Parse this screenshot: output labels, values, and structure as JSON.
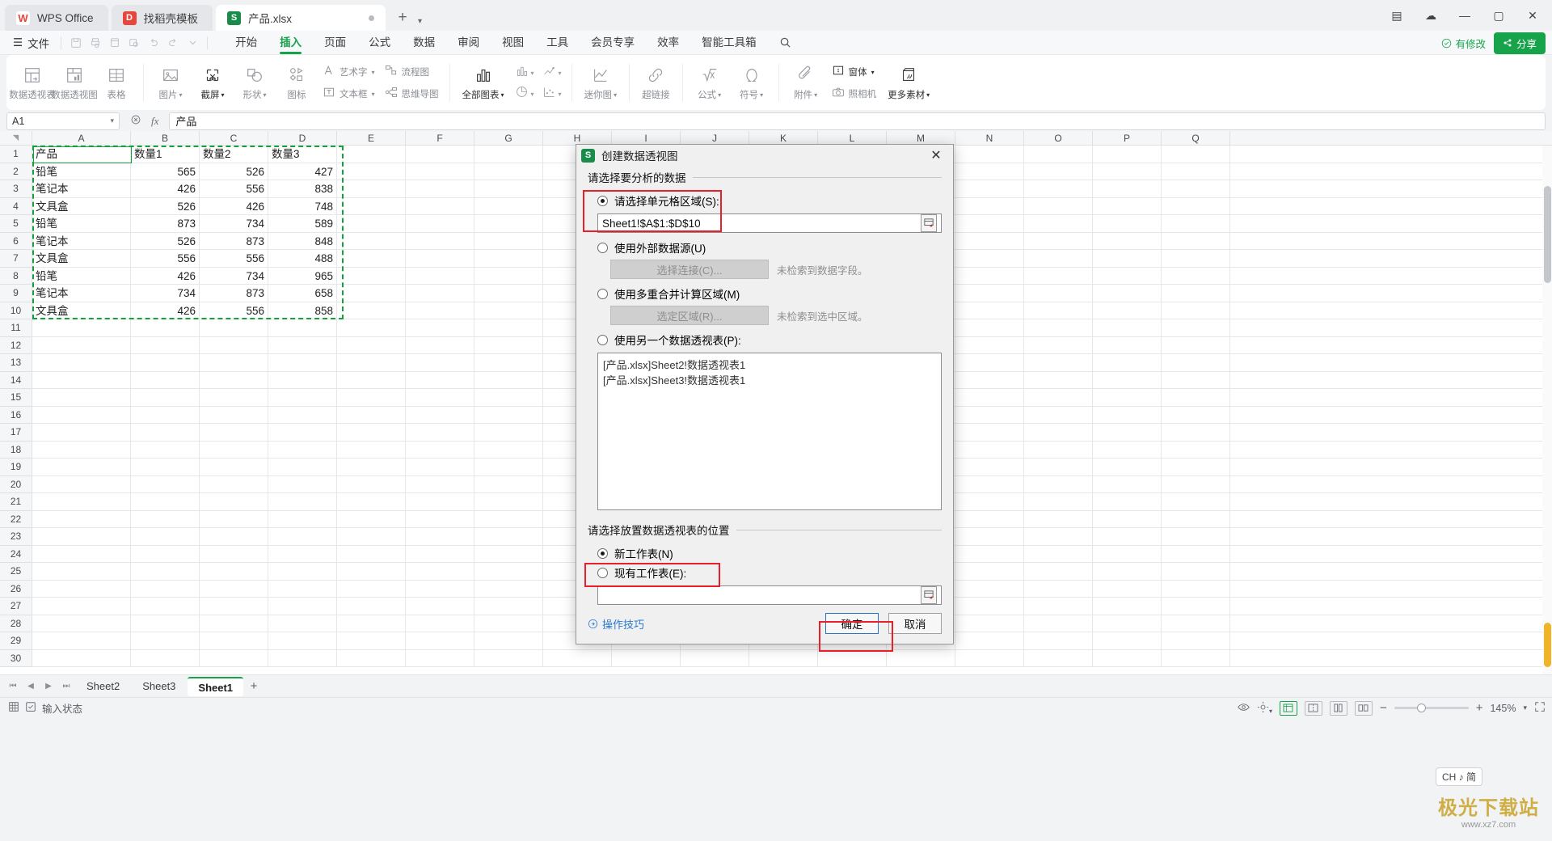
{
  "titlebar": {
    "tabs": [
      {
        "label": "WPS Office",
        "icon": "wps-logo-icon"
      },
      {
        "label": "找稻壳模板",
        "icon": "docer-icon"
      },
      {
        "label": "产品.xlsx",
        "icon": "spreadsheet-icon"
      }
    ],
    "new_tab": "+",
    "tab_dropdown": "▾",
    "window_buttons": {
      "panel": "▤",
      "minimize": "—",
      "maximize": "▢",
      "close": "✕",
      "cloud": "☁"
    }
  },
  "menubar": {
    "file_label": "文件",
    "quick_icons": [
      "save-icon",
      "print-icon",
      "print-preview-icon",
      "print-search-icon",
      "undo-icon",
      "redo-icon",
      "customize-dropdown-icon"
    ],
    "tabs": [
      {
        "label": "开始"
      },
      {
        "label": "插入"
      },
      {
        "label": "页面"
      },
      {
        "label": "公式"
      },
      {
        "label": "数据"
      },
      {
        "label": "审阅"
      },
      {
        "label": "视图"
      },
      {
        "label": "工具"
      },
      {
        "label": "会员专享"
      },
      {
        "label": "效率"
      },
      {
        "label": "智能工具箱"
      }
    ],
    "active_tab": "插入",
    "search_icon": "search-icon",
    "modified_label": "有修改",
    "share_label": "分享"
  },
  "ribbon": {
    "groups": [
      {
        "buttons": [
          {
            "label": "数据透视表",
            "icon": "pivot-table-icon",
            "caret": false
          },
          {
            "label": "数据透视图",
            "icon": "pivot-chart-icon",
            "caret": false
          },
          {
            "label": "表格",
            "icon": "table-icon",
            "caret": false
          }
        ]
      },
      {
        "buttons": [
          {
            "label": "图片",
            "icon": "picture-icon",
            "caret": true
          },
          {
            "label": "截屏",
            "icon": "screenshot-icon",
            "caret": true,
            "dark": true
          },
          {
            "label": "形状",
            "icon": "shapes-icon",
            "caret": true
          },
          {
            "label": "图标",
            "icon": "icons-icon",
            "caret": false
          }
        ],
        "stack": [
          {
            "label": "艺术字",
            "icon": "wordart-icon",
            "caret": true
          },
          {
            "label": "文本框",
            "icon": "textbox-icon",
            "caret": true
          }
        ],
        "stack2": [
          {
            "label": "流程图",
            "icon": "flowchart-icon",
            "caret": false
          },
          {
            "label": "思维导图",
            "icon": "mindmap-icon",
            "caret": false
          }
        ]
      },
      {
        "buttons": [
          {
            "label": "全部图表",
            "icon": "all-charts-icon",
            "caret": true,
            "dark": true
          }
        ],
        "minis": [
          {
            "icon": "column-chart-icon",
            "caret": true
          },
          {
            "icon": "line-chart-icon",
            "caret": true
          },
          {
            "icon": "pie-chart-icon",
            "caret": true
          },
          {
            "icon": "scatter-chart-icon",
            "caret": true
          }
        ]
      },
      {
        "buttons": [
          {
            "label": "迷你图",
            "icon": "sparkline-icon",
            "caret": true
          }
        ]
      },
      {
        "buttons": [
          {
            "label": "超链接",
            "icon": "hyperlink-icon",
            "caret": false
          }
        ]
      },
      {
        "buttons": [
          {
            "label": "公式",
            "icon": "formula-icon",
            "caret": true
          },
          {
            "label": "符号",
            "icon": "symbol-icon",
            "caret": true
          }
        ]
      },
      {
        "buttons": [
          {
            "label": "附件",
            "icon": "attachment-icon",
            "caret": true
          }
        ],
        "stack": [
          {
            "label": "窗体",
            "icon": "form-icon",
            "caret": true,
            "dark": true
          },
          {
            "label": "照相机",
            "icon": "camera-icon",
            "caret": false
          }
        ],
        "more": {
          "label": "更多素材",
          "icon": "more-material-icon",
          "caret": true,
          "dark": true
        }
      }
    ]
  },
  "formulabar": {
    "namebox_value": "A1",
    "namebox_caret": "▾",
    "icons": [
      "cancel-icon",
      "fx-icon"
    ],
    "fx_label": "fx",
    "formula_value": "产品"
  },
  "grid": {
    "columns": [
      "A",
      "B",
      "C",
      "D",
      "E",
      "F",
      "G",
      "H",
      "I",
      "J",
      "K",
      "L",
      "M",
      "N",
      "O",
      "P",
      "Q"
    ],
    "rows": [
      1,
      2,
      3,
      4,
      5,
      6,
      7,
      8,
      9,
      10,
      11,
      12,
      13,
      14,
      15,
      16,
      17,
      18,
      19,
      20,
      21,
      22,
      23,
      24,
      25,
      26,
      27,
      28,
      29,
      30
    ],
    "headers": [
      "产品",
      "数量1",
      "数量2",
      "数量3"
    ],
    "data": [
      [
        "铅笔",
        "565",
        "526",
        "427"
      ],
      [
        "笔记本",
        "426",
        "556",
        "838"
      ],
      [
        "文具盒",
        "526",
        "426",
        "748"
      ],
      [
        "铅笔",
        "873",
        "734",
        "589"
      ],
      [
        "笔记本",
        "526",
        "873",
        "848"
      ],
      [
        "文具盒",
        "556",
        "556",
        "488"
      ],
      [
        "铅笔",
        "426",
        "734",
        "965"
      ],
      [
        "笔记本",
        "734",
        "873",
        "658"
      ],
      [
        "文具盒",
        "426",
        "556",
        "858"
      ]
    ]
  },
  "dialog": {
    "icon": "spreadsheet-icon",
    "title": "创建数据透视图",
    "close_label": "✕",
    "section1_title": "请选择要分析的数据",
    "opt_range_label": "请选择单元格区域(S):",
    "range_value": "Sheet1!$A$1:$D$10",
    "opt_external_label": "使用外部数据源(U)",
    "btn_choose_conn": "选择连接(C)...",
    "hint_no_field": "未检索到数据字段。",
    "opt_multi_label": "使用多重合并计算区域(M)",
    "btn_choose_range": "选定区域(R)...",
    "hint_no_range": "未检索到选中区域。",
    "opt_another_pivot_label": "使用另一个数据透视表(P):",
    "pivot_list": [
      "[产品.xlsx]Sheet2!数据透视表1",
      "[产品.xlsx]Sheet3!数据透视表1"
    ],
    "section2_title": "请选择放置数据透视表的位置",
    "opt_new_sheet_label": "新工作表(N)",
    "opt_existing_sheet_label": "现有工作表(E):",
    "existing_sheet_value": "",
    "tips_label": "操作技巧",
    "ok_label": "确定",
    "cancel_label": "取消",
    "highlight_color": "#e8202a",
    "selected_data_source": "range",
    "selected_location": "new_sheet"
  },
  "sheetbar": {
    "nav": [
      "⏮",
      "◀",
      "▶",
      "⏭"
    ],
    "sheets": [
      "Sheet2",
      "Sheet3",
      "Sheet1"
    ],
    "active_sheet": "Sheet1",
    "add_label": "+"
  },
  "statusbar": {
    "left_icons": [
      "grid-icon",
      "checkbox-icon"
    ],
    "status_text": "输入状态",
    "view_icons": [
      "eye-icon",
      "settings-icon"
    ],
    "layout_icons": [
      "normal-view-icon",
      "page-break-icon",
      "page-layout-icon",
      "reading-view-icon"
    ],
    "zoom_value": "145%",
    "zoom_caret": "▾",
    "zoom_out": "−",
    "zoom_in": "+",
    "fullscreen_icon": "fullscreen-icon"
  },
  "ime": {
    "label": "CH ♪ 简"
  },
  "watermark": {
    "line1": "极光下载站",
    "line2": "www.xz7.com"
  }
}
